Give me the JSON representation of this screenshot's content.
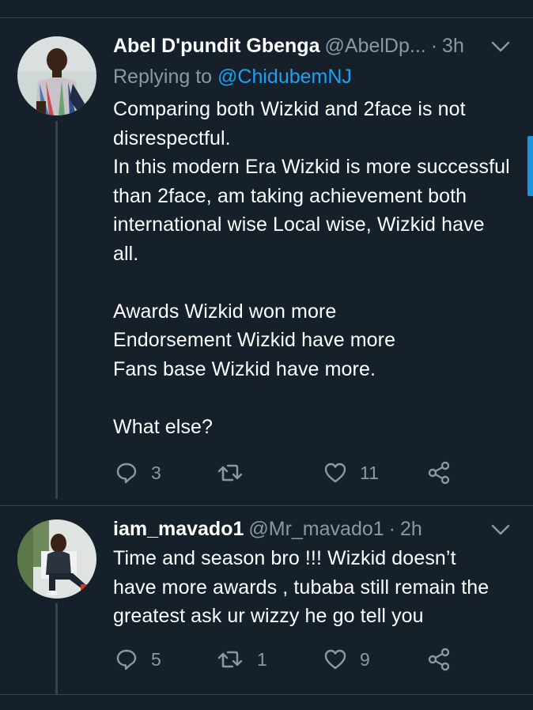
{
  "tweets": [
    {
      "name": "Abel D'pundit Gbenga",
      "handle": "@AbelDp...",
      "separator": "·",
      "time": "3h",
      "replying_prefix": "Replying to ",
      "replying_mention": "@ChidubemNJ",
      "text": "Comparing both Wizkid and 2face is not disrespectful.\nIn this modern Era Wizkid is more successful than 2face, am taking achievement both international wise Local wise, Wizkid have all.\n\nAwards Wizkid won more\nEndorsement Wizkid have more\nFans base Wizkid have more.\n\nWhat else?",
      "actions": {
        "replies": "3",
        "retweets": "",
        "likes": "11"
      }
    },
    {
      "name": "iam_mavado1",
      "handle": "@Mr_mavado1",
      "separator": "·",
      "time": "2h",
      "text": "Time and season bro !!! Wizkid doesn’t have more awards , tubaba still remain the greatest ask ur wizzy he go tell you",
      "actions": {
        "replies": "5",
        "retweets": "1",
        "likes": "9"
      }
    }
  ],
  "icons": {
    "reply": "reply-icon",
    "retweet": "retweet-icon",
    "like": "heart-icon",
    "share": "share-icon",
    "menu": "chevron-down-icon"
  },
  "colors": {
    "background": "#15202b",
    "secondary_text": "#8899a6",
    "link": "#1da1f2",
    "divider": "#38444d"
  }
}
